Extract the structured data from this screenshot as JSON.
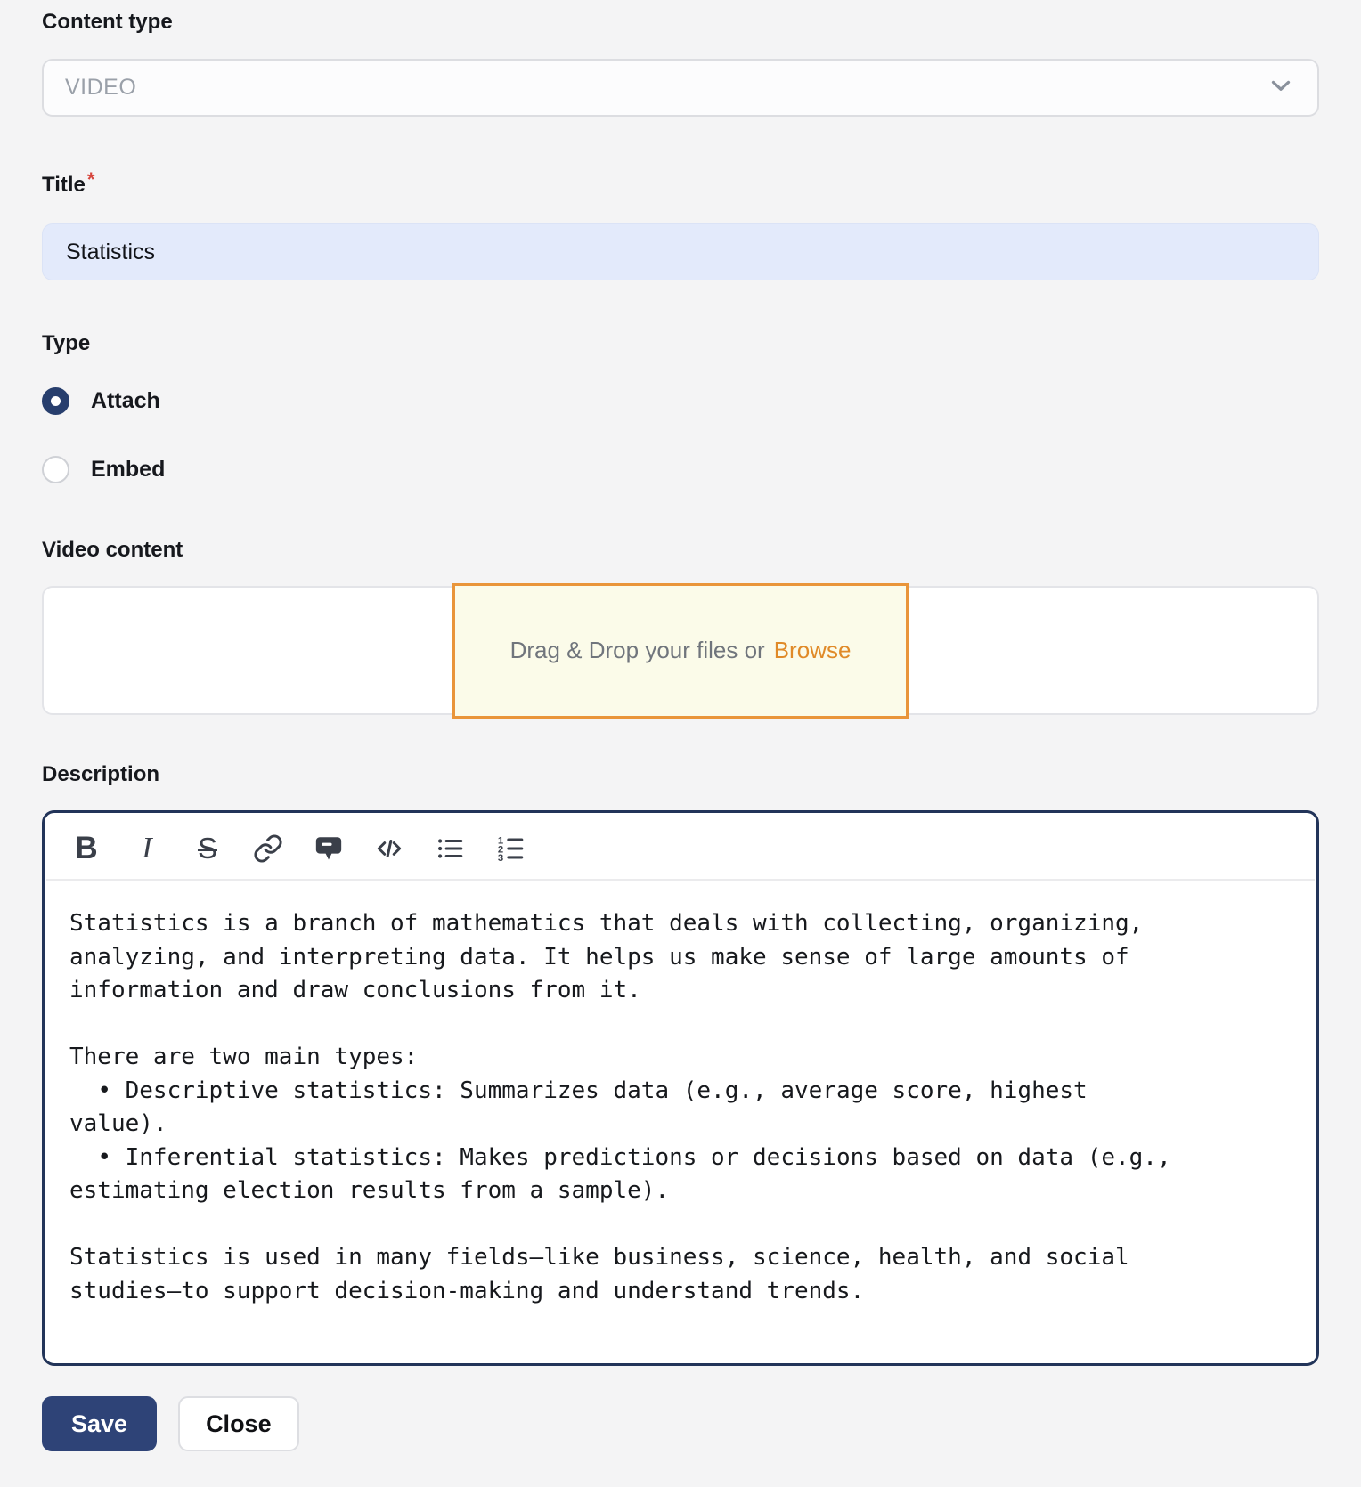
{
  "form": {
    "content_type": {
      "label": "Content type",
      "value": "VIDEO"
    },
    "title": {
      "label": "Title",
      "required_mark": "*",
      "value": "Statistics"
    },
    "type": {
      "label": "Type",
      "options": [
        {
          "label": "Attach",
          "selected": true
        },
        {
          "label": "Embed",
          "selected": false
        }
      ]
    },
    "video_content": {
      "label": "Video content",
      "dropzone_text": "Drag & Drop your files or",
      "browse_label": "Browse"
    },
    "description": {
      "label": "Description",
      "toolbar_icons": [
        "bold",
        "italic",
        "strikethrough",
        "link",
        "comment",
        "code",
        "bullet-list",
        "ordered-list"
      ],
      "value": "Statistics is a branch of mathematics that deals with collecting, organizing,\nanalyzing, and interpreting data. It helps us make sense of large amounts of\ninformation and draw conclusions from it.\n\nThere are two main types:\n  • Descriptive statistics: Summarizes data (e.g., average score, highest\nvalue).\n  • Inferential statistics: Makes predictions or decisions based on data (e.g.,\nestimating election results from a sample).\n\nStatistics is used in many fields—like business, science, health, and social\nstudies—to support decision-making and understand trends."
    },
    "actions": {
      "save_label": "Save",
      "close_label": "Close"
    }
  },
  "toolbar_labels": {
    "bold": "B",
    "italic": "I",
    "strikethrough": "S",
    "code": "</>"
  },
  "colors": {
    "navy_accent": "#2e4377",
    "radio_selected": "#273e6d",
    "editor_border": "#223459",
    "dropzone_border": "#e9953a",
    "dropzone_bg": "#fbfbe9",
    "browse_link": "#e08a28",
    "title_field_bg": "#e3eafb",
    "required_asterisk": "#d6453d",
    "page_bg": "#f4f4f5"
  }
}
